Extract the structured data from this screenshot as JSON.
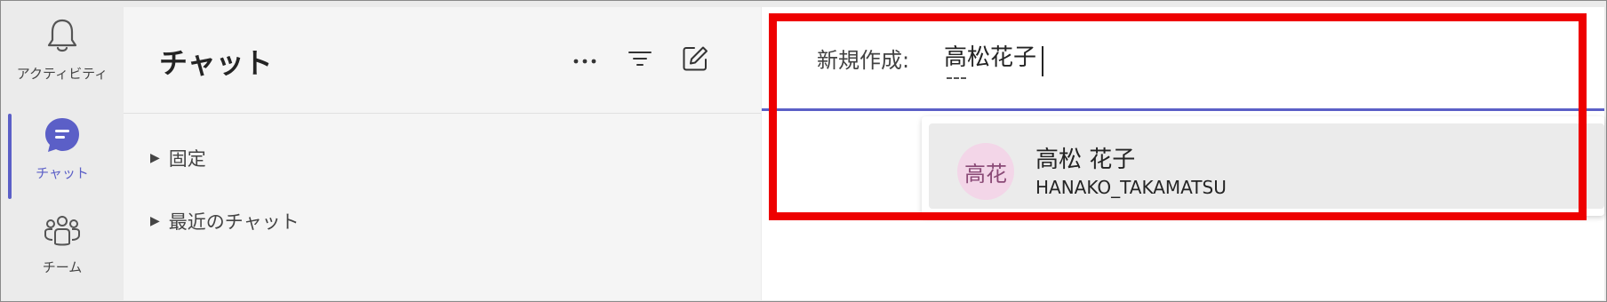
{
  "rail": {
    "items": [
      {
        "label": "アクティビティ",
        "icon": "bell-icon"
      },
      {
        "label": "チャット",
        "icon": "chat-icon"
      },
      {
        "label": "チーム",
        "icon": "teams-icon"
      }
    ],
    "active_color": "#5b5fc7"
  },
  "chat_list": {
    "title": "チャット",
    "header_buttons": [
      "more-options-icon",
      "filter-icon",
      "new-chat-icon"
    ],
    "sections": [
      {
        "label": "固定"
      },
      {
        "label": "最近のチャット"
      }
    ]
  },
  "compose": {
    "to_label": "新規作成:",
    "input_value": "高松花子",
    "suggestion": {
      "avatar_initials": "高花",
      "name": "高松 花子",
      "sub": "HANAKO_TAKAMATSU"
    }
  },
  "colors": {
    "accent": "#5b5fc7",
    "highlight": "#ee0000",
    "avatar_bg": "#f3d6e8"
  }
}
